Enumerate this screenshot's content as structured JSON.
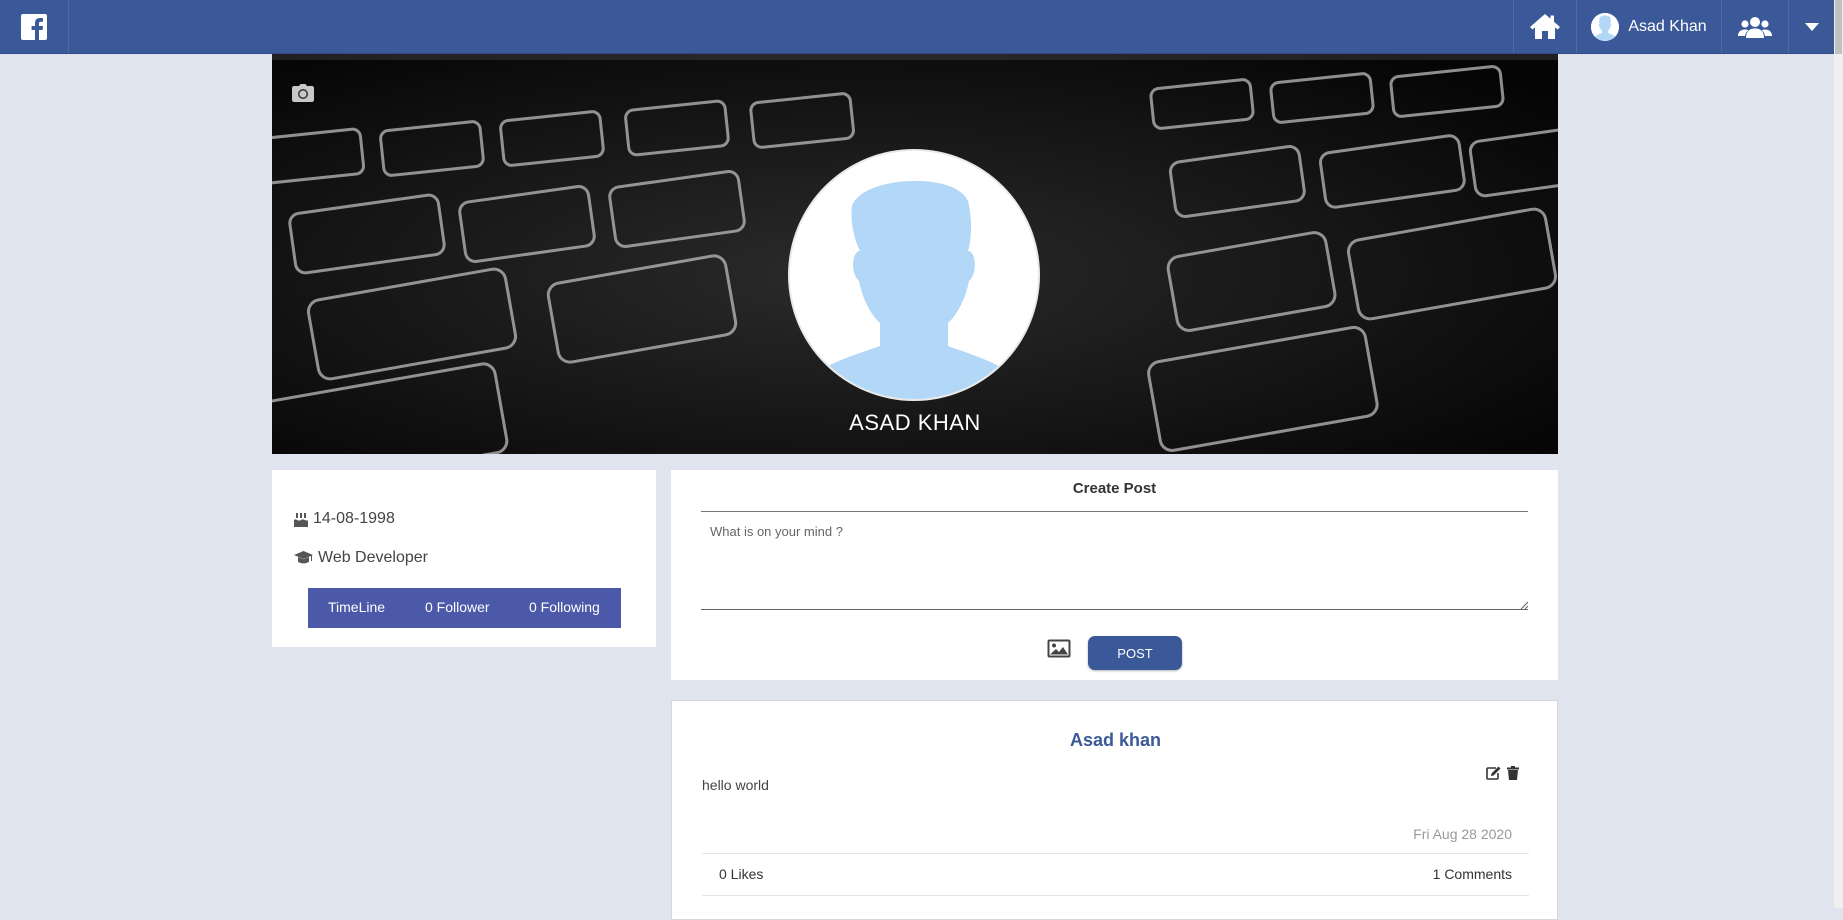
{
  "nav": {
    "logo": "facebook-f-icon",
    "home_icon": "home-icon",
    "user_name": "Asad Khan",
    "friends_icon": "users-icon",
    "menu_icon": "caret-down-icon",
    "brand_color": "#3b5998"
  },
  "cover": {
    "camera_icon": "camera-icon",
    "profile_name": "ASAD KHAN"
  },
  "info": {
    "birthday_icon": "birthday-cake-icon",
    "birthday": "14-08-1998",
    "occupation_icon": "graduation-cap-icon",
    "occupation": "Web Developer",
    "stats": {
      "timeline": "TimeLine",
      "followers": "0 Follower",
      "following": "0 Following",
      "color": "#4b59a8"
    }
  },
  "create_post": {
    "title": "Create Post",
    "placeholder": "What is on your mind ?",
    "image_icon": "image-icon",
    "post_button": "POST"
  },
  "feed": {
    "posts": [
      {
        "author": "Asad khan",
        "text": "hello world",
        "date": "Fri Aug 28 2020",
        "likes": "0 Likes",
        "comments": "1 Comments",
        "edit_icon": "edit-icon",
        "delete_icon": "trash-icon"
      }
    ]
  }
}
